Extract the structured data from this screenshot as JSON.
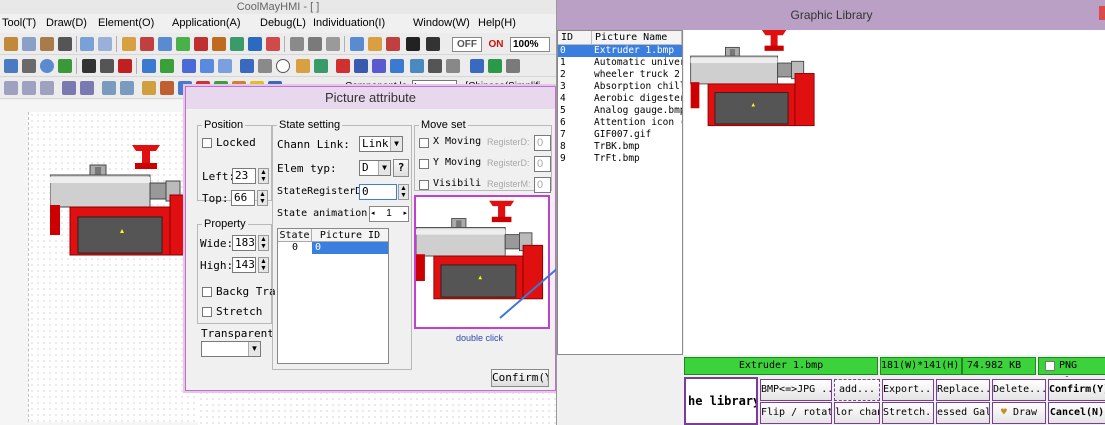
{
  "main_window": {
    "title": "CoolMayHMI - [ ]",
    "menu": [
      "Tool(T)",
      "Draw(D)",
      "Element(O)",
      "Application(A)",
      "Debug(L)",
      "Individuation(I)",
      "Window(W)",
      "Help(H)"
    ],
    "toolbar": {
      "off_label": "OFF",
      "on_label": "ON",
      "zoom_value": "100%",
      "component_label": "Component la",
      "language_select": "Languag",
      "language_value": "-[Chinese(Simplifi"
    }
  },
  "picture_attribute": {
    "title": "Picture attribute",
    "position": {
      "group_label": "Position",
      "locked_label": "Locked",
      "left_label": "Left:",
      "left_value": "23",
      "top_label": "Top:",
      "top_value": "66"
    },
    "property": {
      "group_label": "Property",
      "wide_label": "Wide:",
      "wide_value": "183",
      "high_label": "High:",
      "high_value": "143",
      "backg_label": "Backg Tra",
      "stretch_label": "Stretch"
    },
    "transparent_label": "Transparent co",
    "state_setting": {
      "group_label": "State setting",
      "chann_link_label": "Chann Link:",
      "chann_link_value": "Link 1",
      "elem_typ_label": "Elem typ:",
      "elem_typ_value": "D",
      "help_button": "?",
      "state_register_label": "StateRegisterD:",
      "state_register_value": "0",
      "state_animation_label": "State animation",
      "state_animation_value": "1",
      "table_headers": [
        "State",
        "Picture ID"
      ],
      "table_rows": [
        {
          "state": "0",
          "picture_id": "0"
        }
      ]
    },
    "move_set": {
      "group_label": "Move set",
      "x_moving_label": "X Moving",
      "x_register_label": "RegisterD:",
      "x_register_value": "0",
      "y_moving_label": "Y Moving",
      "y_register_label": "RegisterD:",
      "y_register_value": "0",
      "visibility_label": "Visibili",
      "visibility_register_label": "RegisterM:",
      "visibility_register_value": "0"
    },
    "double_click_hint": "double click",
    "confirm_button": "Confirm(Y)"
  },
  "graphic_library": {
    "title": "Graphic Library",
    "list_headers": [
      "ID",
      "Picture Name"
    ],
    "items": [
      {
        "id": "0",
        "name": "Extruder 1.bmp",
        "selected": true
      },
      {
        "id": "1",
        "name": "Automatic univers",
        "selected": false
      },
      {
        "id": "2",
        "name": "wheeler truck 2.b",
        "selected": false
      },
      {
        "id": "3",
        "name": "Absorption chille",
        "selected": false
      },
      {
        "id": "4",
        "name": "Aerobic digester",
        "selected": false
      },
      {
        "id": "5",
        "name": "Analog gauge.bmp",
        "selected": false
      },
      {
        "id": "6",
        "name": "Attention icon (e",
        "selected": false
      },
      {
        "id": "7",
        "name": "GIF007.gif",
        "selected": false
      },
      {
        "id": "8",
        "name": "TrBK.bmp",
        "selected": false
      },
      {
        "id": "9",
        "name": "TrFt.bmp",
        "selected": false
      }
    ],
    "status": {
      "file_name": "Extruder 1.bmp",
      "dimensions": "181(W)*141(H)",
      "size": "74.982 KB",
      "png_clear_label": "PNG Clear"
    },
    "library_name": "he library",
    "buttons_row1": [
      "BMP<=>JPG ...",
      "add...",
      "Export...",
      "Replace...",
      "Delete...",
      "Confirm(Y)"
    ],
    "buttons_row2": [
      "Flip / rotate",
      "lor change",
      "Stretch...",
      "essed Gal",
      "Draw",
      "Cancel(N)"
    ]
  },
  "colors": {
    "selection_blue": "#3a7fe0",
    "status_green": "#3bd23b",
    "dialog_border": "#c070c8",
    "arrow_blue": "#3c78d8",
    "extruder_red": "#e01010"
  }
}
